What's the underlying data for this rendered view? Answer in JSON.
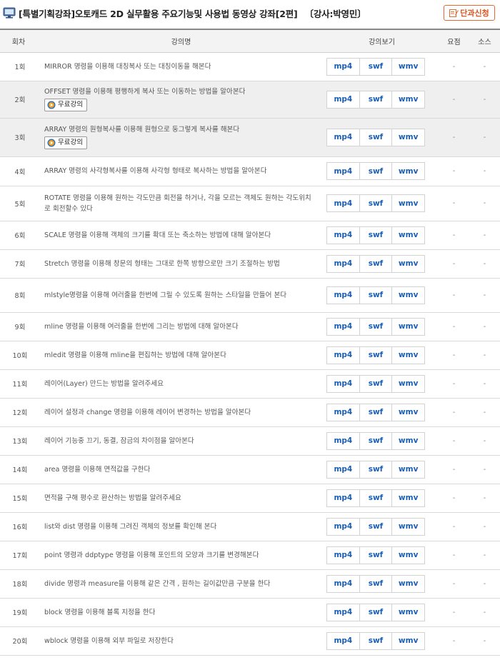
{
  "header": {
    "title": "[특별기획강좌]오토캐드 2D 실무활용 주요기능및 사용법 동영상 강좌[2편]",
    "instructor": "〔강사:박영민〕",
    "apply_label": "단과신청",
    "icon": "monitor-icon"
  },
  "table": {
    "columns": [
      "회차",
      "강의명",
      "강의보기",
      "요점",
      "소스"
    ],
    "formats": [
      "mp4",
      "swf",
      "wmv"
    ],
    "free_label": "무료강의",
    "rows": [
      {
        "no": "1회",
        "title": "MIRROR 명령을 이용해 대칭복사 또는 대칭이동을 해본다",
        "free": false,
        "summary": "-",
        "source": "-"
      },
      {
        "no": "2회",
        "title": "OFFSET 명령을 이용해 평행하게 복사 또는 이동하는 방법을 알아본다",
        "free": true,
        "summary": "-",
        "source": "-"
      },
      {
        "no": "3회",
        "title": "ARRAY 명령의 원형복사를 이용해 원형으로 둥그렇게 복사를 해본다",
        "free": true,
        "summary": "-",
        "source": "-"
      },
      {
        "no": "4회",
        "title": "ARRAY 명령의 사각형복사를 이용해 사각형 형태로 복사하는 방법을 알아본다",
        "free": false,
        "summary": "-",
        "source": "-"
      },
      {
        "no": "5회",
        "title": "ROTATE 명령을 이용해 원하는 각도만큼 회전을 하거나, 각을 모르는 객체도 원하는 각도위치로 회전할수 있다",
        "free": false,
        "summary": "-",
        "source": "-"
      },
      {
        "no": "6회",
        "title": "SCALE 명령을 이용해 객체의 크기를 확대 또는 축소하는 방법에 대해 알아본다",
        "free": false,
        "summary": "-",
        "source": "-"
      },
      {
        "no": "7회",
        "title": "Stretch 명령을 이용해 창문의 형태는 그대로 한쪽 방향으로만 크기 조절하는 방법",
        "free": false,
        "summary": "-",
        "source": "-"
      },
      {
        "no": "8회",
        "title": "mlstyle명령을 이용해 여러줄을 한번에 그릴 수 있도록 원하는 스타일을 만들어 본다",
        "free": false,
        "summary": "-",
        "source": "-"
      },
      {
        "no": "9회",
        "title": "mline 명령을 이용해 여러줄을 한번에 그리는 방법에 대해 알아본다",
        "free": false,
        "summary": "-",
        "source": "-"
      },
      {
        "no": "10회",
        "title": "mledit 명령을 이용해 mline을 편집하는 방법에 대해 알아본다",
        "free": false,
        "summary": "-",
        "source": "-"
      },
      {
        "no": "11회",
        "title": "레이어(Layer) 만드는 방법을 알려주세요",
        "free": false,
        "summary": "-",
        "source": "-"
      },
      {
        "no": "12회",
        "title": "레이어 설정과 change 명령을 이용해 레이어 변경하는 방법을 알아본다",
        "free": false,
        "summary": "-",
        "source": "-"
      },
      {
        "no": "13회",
        "title": "레이어 기능중 끄기, 동결, 잠금의 차이점을 알아본다",
        "free": false,
        "summary": "-",
        "source": "-"
      },
      {
        "no": "14회",
        "title": "area 명령을 이용해 면적값을 구한다",
        "free": false,
        "summary": "-",
        "source": "-"
      },
      {
        "no": "15회",
        "title": "면적을 구해 평수로 환산하는 방법을 알려주세요",
        "free": false,
        "summary": "-",
        "source": "-"
      },
      {
        "no": "16회",
        "title": "list와 dist 명령을 이용해 그려진 객체의 정보를 확인해 본다",
        "free": false,
        "summary": "-",
        "source": "-"
      },
      {
        "no": "17회",
        "title": "point 명령과 ddptype 명령을 이용해 포인트의 모양과 크기를 변경해본다",
        "free": false,
        "summary": "-",
        "source": "-"
      },
      {
        "no": "18회",
        "title": "divide 명령과 measure을 이용해 같은 간격 , 원하는 길이값만큼 구분을 한다",
        "free": false,
        "summary": "-",
        "source": "-"
      },
      {
        "no": "19회",
        "title": "block 명령을 이용해 블록 지정을 한다",
        "free": false,
        "summary": "-",
        "source": "-"
      },
      {
        "no": "20회",
        "title": "wblock 명령을 이용해 외부 파일로 저장한다",
        "free": false,
        "summary": "-",
        "source": "-"
      }
    ]
  },
  "colors": {
    "accent_orange": "#e46a2f",
    "link_blue": "#1a5fb4",
    "free_row_bg": "#efefef"
  }
}
